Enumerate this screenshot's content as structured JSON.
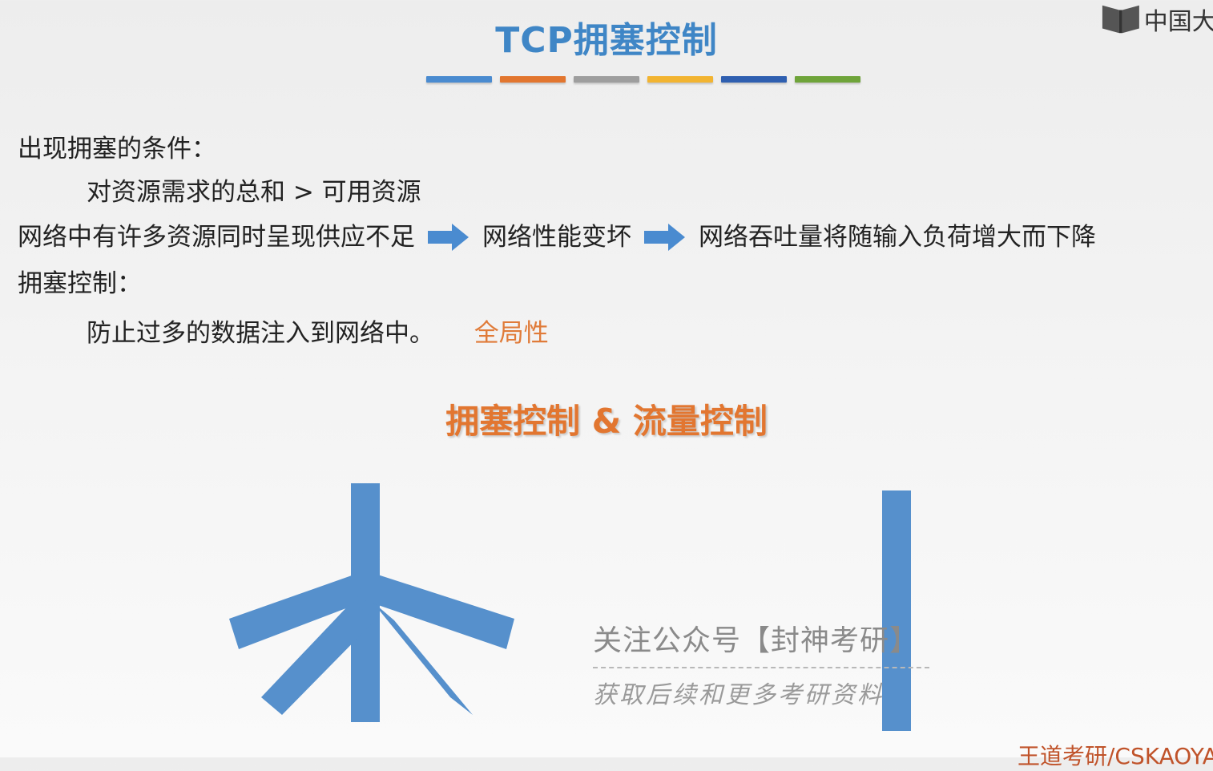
{
  "slide": {
    "title": "TCP拥塞控制",
    "title_bar_colors": [
      "#4a8bd0",
      "#e2762f",
      "#9e9e9e",
      "#f2b431",
      "#2f5fb0",
      "#6fa43a"
    ]
  },
  "logo": {
    "text": "中国大",
    "icon": "book-icon"
  },
  "content": {
    "condition_label": "出现拥塞的条件：",
    "condition_text": "对资源需求的总和 > 可用资源",
    "flow": {
      "step1": "网络中有许多资源同时呈现供应不足",
      "step2": "网络性能变坏",
      "step3": "网络吞吐量将随输入负荷增大而下降",
      "arrow_icon": "right-arrow-icon"
    },
    "control_label": "拥塞控制：",
    "control_text": "防止过多的数据注入到网络中。",
    "control_tag": "全局性"
  },
  "comparison_heading": "拥塞控制 & 流量控制",
  "watermark": {
    "line1": "关注公众号【封神考研】",
    "line2": "获取后续和更多考研资料"
  },
  "footer_credit": "王道考研/CSKAOYAN",
  "colors": {
    "accent_blue": "#3f86c6",
    "accent_orange": "#e27630",
    "diagram_blue": "#5690cc"
  }
}
